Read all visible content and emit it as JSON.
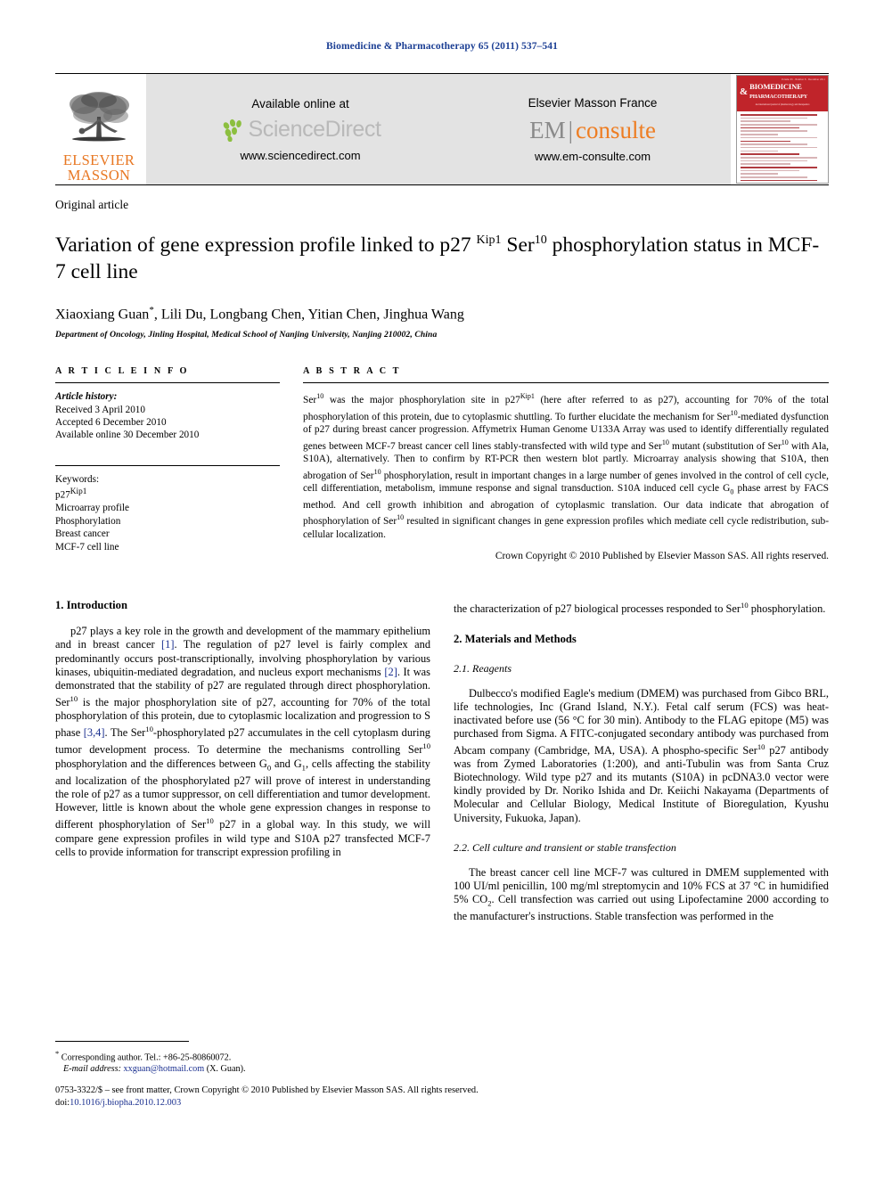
{
  "running_head": "Biomedicine & Pharmacotherapy 65 (2011) 537–541",
  "masthead": {
    "publisher_line1": "ELSEVIER",
    "publisher_line2": "MASSON",
    "sciencedirect": {
      "caption": "Available online at",
      "wordmark": "ScienceDirect",
      "url": "www.sciencedirect.com"
    },
    "emconsulte": {
      "caption": "Elsevier Masson France",
      "wordmark_left": "EM",
      "wordmark_right": "consulte",
      "url": "www.em-consulte.com"
    },
    "cover": {
      "amp": "&",
      "title_line1": "BIOMEDICINE",
      "title_line2": "PHARMACOTHERAPY",
      "top_note": "Volume 65 . Number 8 . December 2011",
      "sub_note": "An international journal of pharmacology and therapeutics"
    }
  },
  "article": {
    "type": "Original article",
    "title_part1": "Variation of gene expression profile linked to p27 ",
    "title_sup1": "Kip1",
    "title_part2": " Ser",
    "title_sup2": "10",
    "title_part3": " phosphorylation status in MCF-7 cell line",
    "authors": "Xiaoxiang Guan",
    "authors_sup": "*",
    "authors_rest": ", Lili Du, Longbang Chen, Yitian Chen, Jinghua Wang",
    "affiliation": "Department of Oncology, Jinling Hospital, Medical School of Nanjing University, Nanjing 210002, China"
  },
  "article_info": {
    "heading": "A R T I C L E    I N F O",
    "history_label": "Article history:",
    "received": "Received 3 April 2010",
    "accepted": "Accepted 6 December 2010",
    "available": "Available online 30 December 2010",
    "keywords_label": "Keywords:",
    "keywords": [
      "p27Kip1",
      "Microarray profile",
      "Phosphorylation",
      "Breast cancer",
      "MCF-7 cell line"
    ],
    "keyword_first_base": "p27",
    "keyword_first_sup": "Kip1"
  },
  "abstract": {
    "heading": "A B S T R A C T",
    "text_segments": [
      {
        "t": "Ser"
      },
      {
        "sup": "10"
      },
      {
        "t": " was the major phosphorylation site in p27"
      },
      {
        "sup": "Kip1"
      },
      {
        "t": " (here after referred to as p27), accounting for 70% of the total phosphorylation of this protein, due to cytoplasmic shuttling. To further elucidate the mechanism for Ser"
      },
      {
        "sup": "10"
      },
      {
        "t": "-mediated dysfunction of p27 during breast cancer progression. Affymetrix Human Genome U133A Array was used to identify differentially regulated genes between MCF-7 breast cancer cell lines stably-transfected with wild type and Ser"
      },
      {
        "sup": "10"
      },
      {
        "t": " mutant (substitution of Ser"
      },
      {
        "sup": "10"
      },
      {
        "t": " with Ala, S10A), alternatively. Then to confirm by RT-PCR then western blot partly. Microarray analysis showing that S10A, then abrogation of Ser"
      },
      {
        "sup": "10"
      },
      {
        "t": " phosphorylation, result in important changes in a large number of genes involved in the control of cell cycle, cell differentiation, metabolism, immune response and signal transduction. S10A induced cell cycle G"
      },
      {
        "sub": "0"
      },
      {
        "t": " phase arrest by FACS method. And cell growth inhibition and abrogation of cytoplasmic translation. Our data indicate that abrogation of phosphorylation of Ser"
      },
      {
        "sup": "10"
      },
      {
        "t": " resulted in significant changes in gene expression profiles which mediate cell cycle redistribution, sub-cellular localization."
      }
    ],
    "copyright": "Crown Copyright © 2010 Published by Elsevier Masson SAS. All rights reserved."
  },
  "body": {
    "intro_heading": "1. Introduction",
    "intro_segments": [
      {
        "t": "p27 plays a key role in the growth and development of the mammary epithelium and in breast cancer "
      },
      {
        "ref": "[1]"
      },
      {
        "t": ". The regulation of p27 level is fairly complex and predominantly occurs post-transcriptionally, involving phosphorylation by various kinases, ubiquitin-mediated degradation, and nucleus export mechanisms "
      },
      {
        "ref": "[2]"
      },
      {
        "t": ". It was demonstrated that the stability of p27 are regulated through direct phosphorylation. Ser"
      },
      {
        "sup": "10"
      },
      {
        "t": " is the major phosphorylation site of p27, accounting for 70% of the total phosphorylation of this protein, due to cytoplasmic localization and progression to S phase "
      },
      {
        "ref": "[3,4]"
      },
      {
        "t": ". The Ser"
      },
      {
        "sup": "10"
      },
      {
        "t": "-phosphorylated p27 accumulates in the cell cytoplasm during tumor development process. To determine the mechanisms controlling Ser"
      },
      {
        "sup": "10"
      },
      {
        "t": " phosphorylation and the differences between G"
      },
      {
        "sub": "0"
      },
      {
        "t": " and G"
      },
      {
        "sub": "1"
      },
      {
        "t": ", cells affecting the stability and localization of the phosphorylated p27 will prove of interest in understanding the role of p27 as a tumor suppressor, on cell differentiation and tumor development. However, little is known about the whole gene expression changes in response to different phosphorylation of Ser"
      },
      {
        "sup": "10"
      },
      {
        "t": " p27 in a global way. In this study, we will compare gene expression profiles in wild type and S10A p27 transfected MCF-7 cells to provide information for transcript expression profiling in"
      }
    ],
    "right_continuation_segments": [
      {
        "t": "the characterization of p27 biological processes responded to Ser"
      },
      {
        "sup": "10"
      },
      {
        "t": " phosphorylation."
      }
    ],
    "methods_heading": "2. Materials and Methods",
    "reagents_heading": "2.1. Reagents",
    "reagents_segments": [
      {
        "t": "Dulbecco's modified Eagle's medium (DMEM) was purchased from Gibco BRL, life technologies, Inc (Grand Island, N.Y.). Fetal calf serum (FCS) was heat-inactivated before use (56 °C for 30 min). Antibody to the FLAG epitope (M5) was purchased from Sigma. A FITC-conjugated secondary antibody was purchased from Abcam company (Cambridge, MA, USA). A phospho-specific Ser"
      },
      {
        "sup": "10"
      },
      {
        "t": " p27 antibody was from Zymed Laboratories (1:200), and anti-Tubulin was from Santa Cruz Biotechnology. Wild type p27 and its mutants (S10A) in pcDNA3.0 vector were kindly provided by Dr. Noriko Ishida and Dr. Keiichi Nakayama (Departments of Molecular and Cellular Biology, Medical Institute of Bioregulation, Kyushu University, Fukuoka, Japan)."
      }
    ],
    "transfection_heading": "2.2. Cell culture and transient or stable transfection",
    "transfection_segments": [
      {
        "t": "The breast cancer cell line MCF-7 was cultured in DMEM supplemented with 100 UI/ml penicillin, 100 mg/ml streptomycin and 10% FCS at 37 °C in humidified 5% CO"
      },
      {
        "sub": "2"
      },
      {
        "t": ". Cell transfection was carried out using Lipofectamine 2000 according to the manufacturer's instructions. Stable transfection was performed in the"
      }
    ]
  },
  "footnote": {
    "marker": "*",
    "corresponding": "Corresponding author. Tel.: +86-25-80860072.",
    "email_label": "E-mail address:",
    "email": "xxguan@hotmail.com",
    "email_owner": "(X. Guan)."
  },
  "page_footer": {
    "line1": "0753-3322/$ – see front matter, Crown Copyright © 2010 Published by Elsevier Masson SAS. All rights reserved.",
    "doi_label": "doi:",
    "doi": "10.1016/j.biopha.2010.12.003"
  },
  "colors": {
    "journal_blue": "#1c3f94",
    "reference_blue": "#1a2f8f",
    "elsevier_orange": "#e87722",
    "em_orange": "#ee7d22",
    "cover_red": "#c0242a",
    "banner_grey": "#e3e3e3"
  }
}
